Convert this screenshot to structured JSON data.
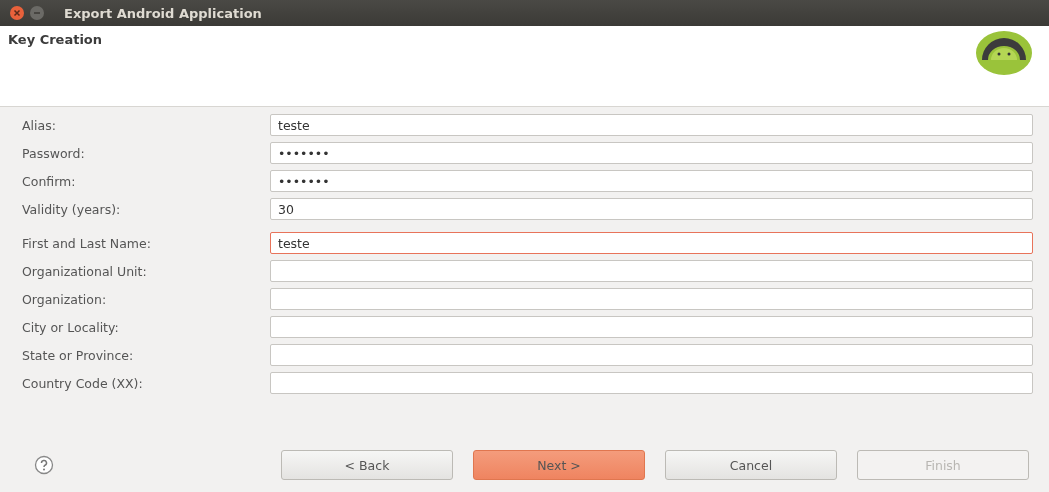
{
  "window": {
    "title": "Export Android Application"
  },
  "header": {
    "title": "Key Creation"
  },
  "key_fields": [
    {
      "label": "Alias:",
      "value": "teste",
      "focused": false
    },
    {
      "label": "Password:",
      "value": "•••••••",
      "focused": false
    },
    {
      "label": "Confirm:",
      "value": "•••••••",
      "focused": false
    },
    {
      "label": "Validity (years):",
      "value": "30",
      "focused": false
    }
  ],
  "owner_fields": [
    {
      "label": "First and Last Name:",
      "value": "teste",
      "focused": true
    },
    {
      "label": "Organizational Unit:",
      "focused": false
    },
    {
      "label": "Organization:",
      "focused": false
    },
    {
      "label": "City or Locality:",
      "focused": false
    },
    {
      "label": "State or Province:",
      "focused": false
    },
    {
      "label": "Country Code (XX):",
      "focused": false
    }
  ],
  "buttons": [
    {
      "label": "< Back",
      "kind": "normal",
      "disabled": false
    },
    {
      "label": "Next >",
      "kind": "primary",
      "disabled": false
    },
    {
      "label": "Cancel",
      "kind": "normal",
      "disabled": false
    },
    {
      "label": "Finish",
      "kind": "normal",
      "disabled": true
    }
  ]
}
